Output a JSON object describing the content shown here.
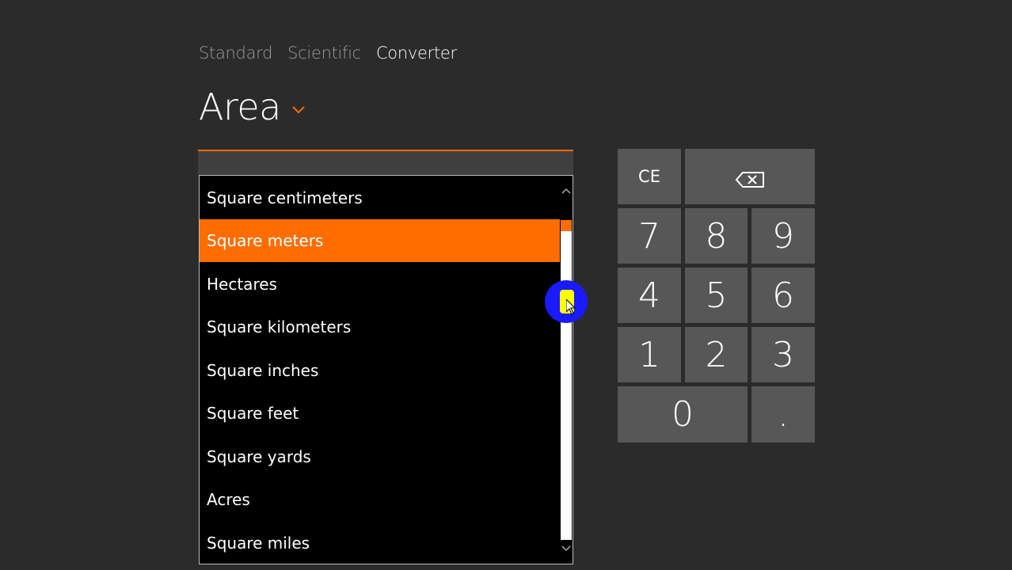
{
  "mode_tabs": [
    "Standard",
    "Scientific",
    "Converter"
  ],
  "active_mode": "Converter",
  "category": "Area",
  "input_value": "",
  "units": [
    "Square centimeters",
    "Square meters",
    "Hectares",
    "Square kilometers",
    "Square inches",
    "Square feet",
    "Square yards",
    "Acres",
    "Square miles"
  ],
  "selected_unit": "Square meters",
  "keypad": {
    "ce": "CE",
    "digits": [
      "7",
      "8",
      "9",
      "4",
      "5",
      "6",
      "1",
      "2",
      "3",
      "0"
    ],
    "decimal": "."
  },
  "colors": {
    "accent": "#ff6d00",
    "background": "#2b2b2b",
    "key": "#575757",
    "list_background": "#000000"
  },
  "icons": {
    "backspace": "backspace-icon",
    "category_chevron": "chevron-down-icon",
    "scroll_up": "scroll-up-arrow-icon",
    "scroll_down": "scroll-down-arrow-icon"
  }
}
